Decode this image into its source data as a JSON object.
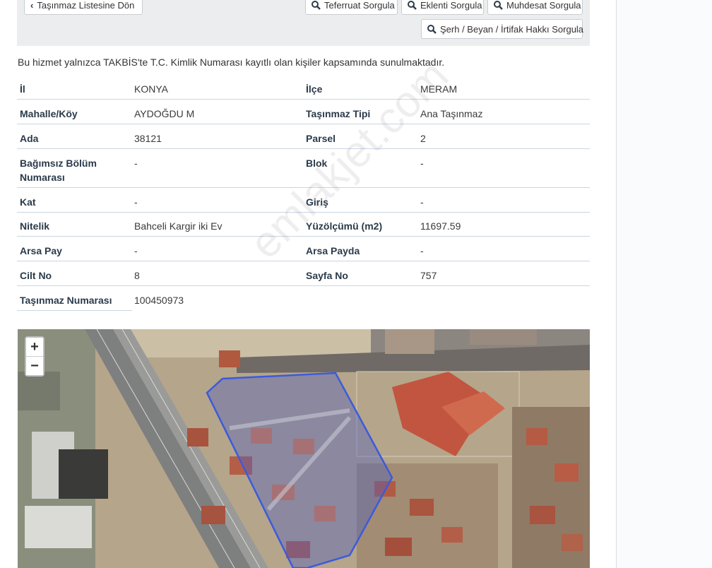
{
  "toolbar": {
    "back_label": "Taşınmaz Listesine Dön",
    "teferruat_label": "Teferruat Sorgula",
    "eklenti_label": "Eklenti Sorgula",
    "muhdesat_label": "Muhdesat Sorgula",
    "serh_label": "Şerh / Beyan / İrtifak Hakkı Sorgula"
  },
  "notice": "Bu hizmet yalnızca TAKBİS'te T.C. Kimlik Numarası kayıtlı olan kişiler kapsamında sunulmaktadır.",
  "info": {
    "rows": [
      {
        "l1": "İl",
        "v1": "KONYA",
        "l2": "İlçe",
        "v2": "MERAM"
      },
      {
        "l1": "Mahalle/Köy",
        "v1": "AYDOĞDU M",
        "l2": "Taşınmaz Tipi",
        "v2": "Ana Taşınmaz"
      },
      {
        "l1": "Ada",
        "v1": "38121",
        "l2": "Parsel",
        "v2": "2"
      },
      {
        "l1": "Bağımsız Bölüm Numarası",
        "v1": "-",
        "l2": "Blok",
        "v2": "-"
      },
      {
        "l1": "Kat",
        "v1": "-",
        "l2": "Giriş",
        "v2": "-"
      },
      {
        "l1": "Nitelik",
        "v1": "Bahceli Kargir iki Ev",
        "l2": "Yüzölçümü (m2)",
        "v2": "11697.59"
      },
      {
        "l1": "Arsa Pay",
        "v1": "-",
        "l2": "Arsa Payda",
        "v2": "-"
      },
      {
        "l1": "Cilt No",
        "v1": "8",
        "l2": "Sayfa No",
        "v2": "757"
      },
      {
        "l1": "Taşınmaz Numarası",
        "v1": "100450973",
        "l2": "",
        "v2": ""
      }
    ]
  },
  "map": {
    "zoom_in": "+",
    "zoom_out": "−",
    "watermark": "emlakjet.com",
    "parcel_color": "#3b5bdb"
  },
  "icons": {
    "back": "chevron-left-icon",
    "search": "search-icon"
  }
}
